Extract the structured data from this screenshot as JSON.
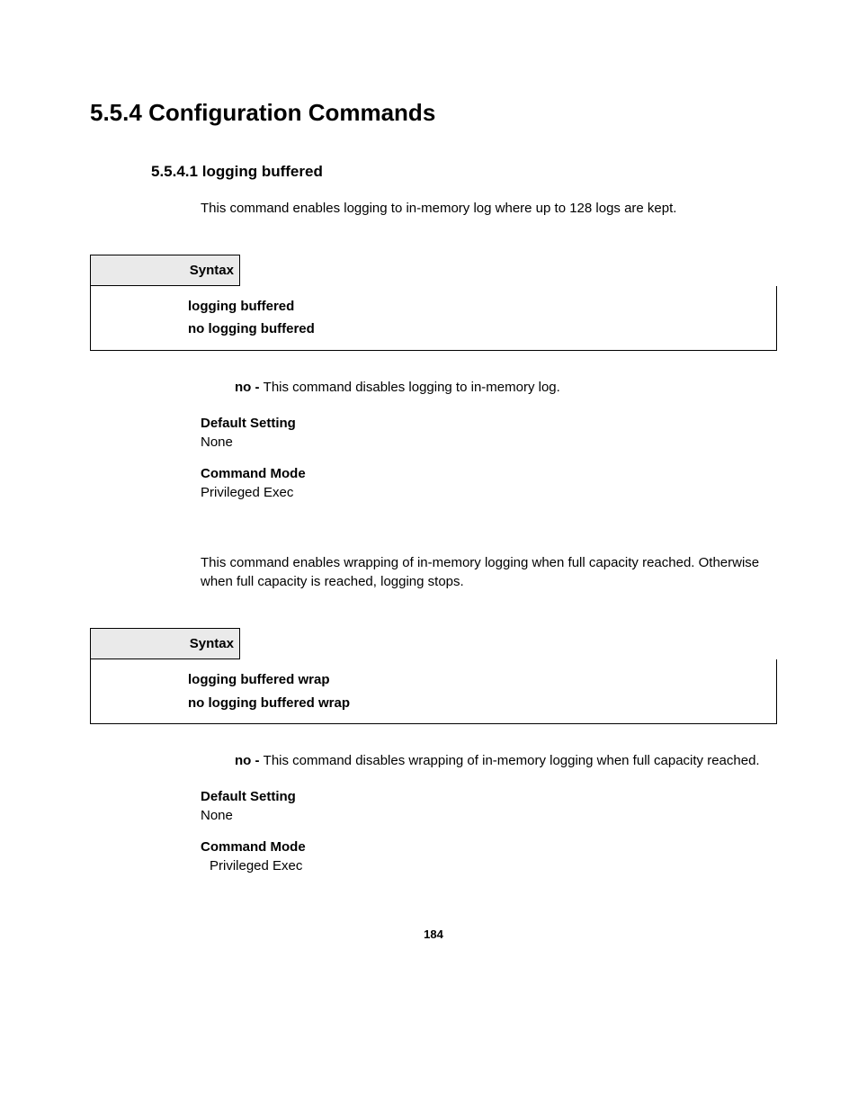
{
  "heading": {
    "number": "5.5.4",
    "title": "Configuration Commands"
  },
  "section1": {
    "subheading_number": "5.5.4.1",
    "subheading_title": "logging buffered",
    "intro": "This command enables logging to in-memory log where up to 128 logs are kept.",
    "syntax_label": "Syntax",
    "syntax_line1": "logging buffered",
    "syntax_line2": "no logging buffered",
    "no_prefix": "no - ",
    "no_text": "This command disables logging to in-memory log.",
    "default_label": "Default Setting",
    "default_value": "None",
    "mode_label": "Command Mode",
    "mode_value": "Privileged Exec"
  },
  "section2": {
    "intro": "This command enables wrapping of in-memory logging when full capacity reached. Otherwise when full capacity is reached, logging stops.",
    "syntax_label": "Syntax",
    "syntax_line1": "logging buffered wrap",
    "syntax_line2": "no logging buffered wrap",
    "no_prefix": "no - ",
    "no_text": "This command disables wrapping of in-memory logging when full capacity reached.",
    "default_label": "Default Setting",
    "default_value": "None",
    "mode_label": "Command Mode",
    "mode_value": "Privileged Exec"
  },
  "page_number": "184"
}
